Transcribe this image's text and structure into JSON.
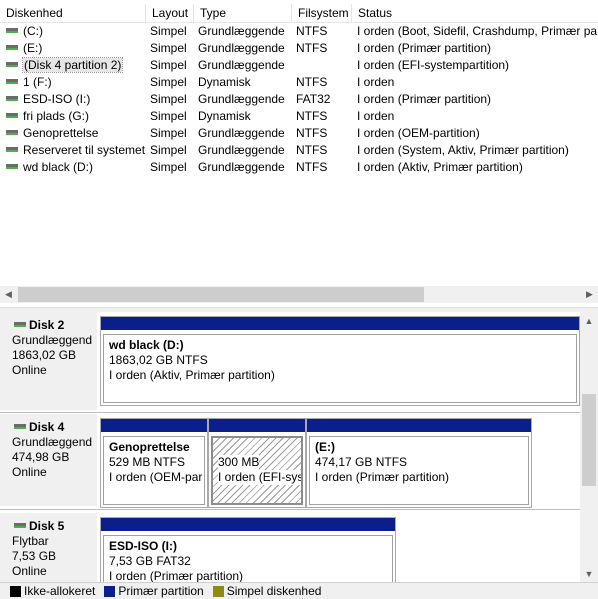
{
  "columns": [
    "Diskenhed",
    "Layout",
    "Type",
    "Filsystem",
    "Status"
  ],
  "volumes": [
    {
      "name": "(C:)",
      "layout": "Simpel",
      "type": "Grundlæggende",
      "fs": "NTFS",
      "status": "I orden (Boot, Sidefil, Crashdump, Primær partition)"
    },
    {
      "name": "(E:)",
      "layout": "Simpel",
      "type": "Grundlæggende",
      "fs": "NTFS",
      "status": "I orden (Primær partition)"
    },
    {
      "name": "(Disk 4 partition 2)",
      "layout": "Simpel",
      "type": "Grundlæggende",
      "fs": "",
      "status": "I orden (EFI-systempartition)"
    },
    {
      "name": "1 (F:)",
      "layout": "Simpel",
      "type": "Dynamisk",
      "fs": "NTFS",
      "status": "I orden"
    },
    {
      "name": "ESD-ISO (I:)",
      "layout": "Simpel",
      "type": "Grundlæggende",
      "fs": "FAT32",
      "status": "I orden (Primær partition)"
    },
    {
      "name": "fri plads (G:)",
      "layout": "Simpel",
      "type": "Dynamisk",
      "fs": "NTFS",
      "status": "I orden"
    },
    {
      "name": "Genoprettelse",
      "layout": "Simpel",
      "type": "Grundlæggende",
      "fs": "NTFS",
      "status": "I orden (OEM-partition)"
    },
    {
      "name": "Reserveret til systemet",
      "layout": "Simpel",
      "type": "Grundlæggende",
      "fs": "NTFS",
      "status": "I orden (System, Aktiv, Primær partition)"
    },
    {
      "name": "wd black (D:)",
      "layout": "Simpel",
      "type": "Grundlæggende",
      "fs": "NTFS",
      "status": "I orden (Aktiv, Primær partition)"
    }
  ],
  "disks": [
    {
      "name": "Disk 2",
      "kind": "Grundlæggend",
      "size": "1863,02 GB",
      "state": "Online",
      "partitions": [
        {
          "name": "wd black  (D:)",
          "size": "1863,02 GB NTFS",
          "status": "I orden (Aktiv, Primær partition)"
        }
      ]
    },
    {
      "name": "Disk 4",
      "kind": "Grundlæggend",
      "size": "474,98 GB",
      "state": "Online",
      "partitions": [
        {
          "name": "Genoprettelse",
          "size": "529 MB NTFS",
          "status": "I orden (OEM-par"
        },
        {
          "name": "",
          "size": "300 MB",
          "status": "I orden (EFI-syst"
        },
        {
          "name": "(E:)",
          "size": "474,17 GB NTFS",
          "status": "I orden (Primær partition)"
        }
      ]
    },
    {
      "name": "Disk 5",
      "kind": "Flytbar",
      "size": "7,53 GB",
      "state": "Online",
      "partitions": [
        {
          "name": "ESD-ISO  (I:)",
          "size": "7,53 GB FAT32",
          "status": "I orden (Primær partition)"
        }
      ]
    }
  ],
  "legend": [
    {
      "label": "Ikke-allokeret",
      "color": "#000000"
    },
    {
      "label": "Primær partition",
      "color": "#0a1e8c"
    },
    {
      "label": "Simpel diskenhed",
      "color": "#8c8c14"
    }
  ],
  "icons": {
    "drive": "drive-icon",
    "scroll_left": "◀",
    "scroll_right": "▶",
    "scroll_up": "▲",
    "scroll_down": "▼"
  }
}
